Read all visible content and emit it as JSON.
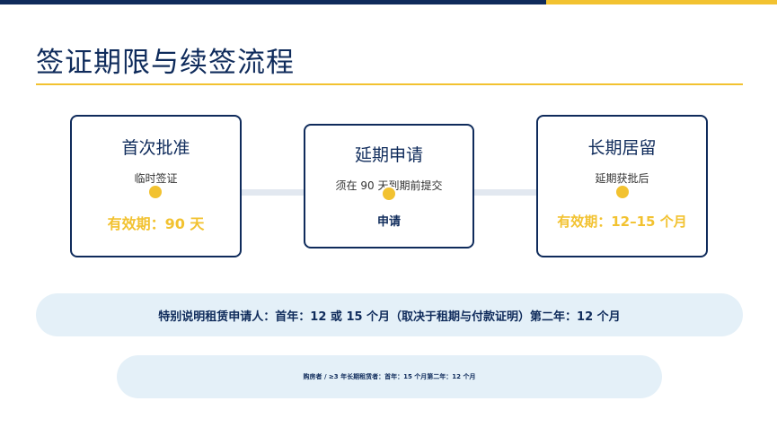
{
  "title": "签证期限与续签流程",
  "steps": [
    {
      "title": "首次批准",
      "subtitle": "临时签证",
      "value": "有效期：90 天"
    },
    {
      "title": "延期申请",
      "subtitle": "须在 90 天到期前提交",
      "value": "申请"
    },
    {
      "title": "长期居留",
      "subtitle": "延期获批后",
      "value": "有效期：12–15 个月"
    }
  ],
  "notes": {
    "primary": "特别说明租赁申请人：首年：12 或 15 个月（取决于租期与付款证明）第二年：12 个月",
    "secondary": "购房者 / ≥3 年长期租赁者：首年：15 个月第二年：12 个月"
  },
  "colors": {
    "navy": "#0f2b5b",
    "gold": "#f2c230",
    "pill": "#e4f0f8"
  }
}
